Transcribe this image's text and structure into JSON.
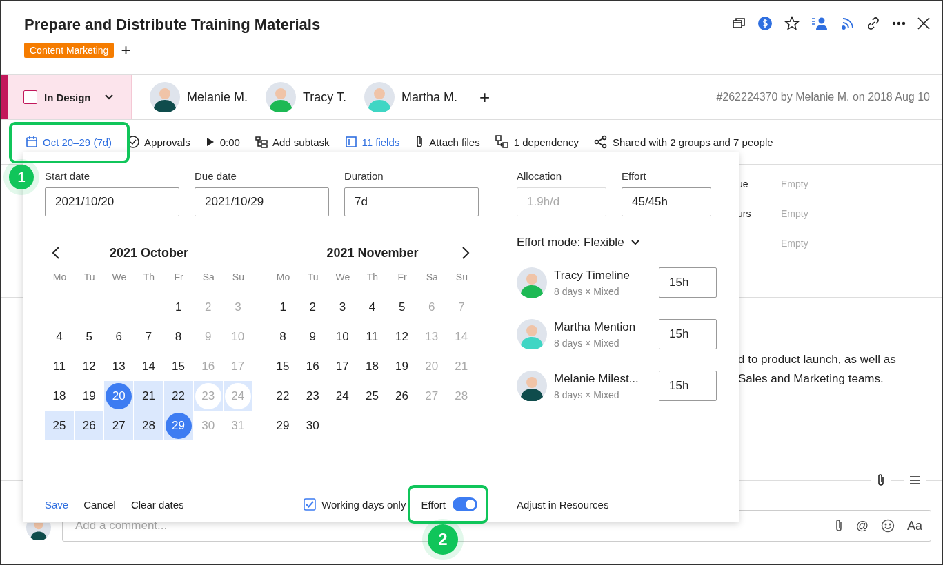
{
  "task": {
    "title": "Prepare and Distribute Training Materials",
    "tags": [
      {
        "label": "Content Marketing",
        "color": "#f57c00"
      }
    ],
    "add_tag": "+"
  },
  "header_icons": [
    {
      "kind": "windows"
    },
    {
      "kind": "dollar"
    },
    {
      "kind": "star"
    },
    {
      "kind": "assign"
    },
    {
      "kind": "feed"
    },
    {
      "kind": "link"
    },
    {
      "kind": "more"
    },
    {
      "kind": "close"
    }
  ],
  "status": {
    "label": "In Design",
    "checked": false,
    "color": "#c2185b"
  },
  "assignees": [
    {
      "name": "Melanie M.",
      "color": "#0f4c4c"
    },
    {
      "name": "Tracy T.",
      "color": "#1db954"
    },
    {
      "name": "Martha M.",
      "color": "#3fd6c4"
    }
  ],
  "add_assignee": "+",
  "meta": "#262224370 by Melanie M. on 2018 Aug 10",
  "toolbar": [
    {
      "kind": "date",
      "label": "Oct 20–29 (7d)",
      "highlighted": true
    },
    {
      "kind": "approvals",
      "label": "Approvals",
      "highlighted": false
    },
    {
      "kind": "timer",
      "label": "0:00",
      "highlighted": false
    },
    {
      "kind": "subtask",
      "label": "Add subtask",
      "highlighted": false
    },
    {
      "kind": "fields",
      "label": "11 fields",
      "highlighted": true
    },
    {
      "kind": "attach",
      "label": "Attach files",
      "highlighted": false
    },
    {
      "kind": "dependency",
      "label": "1 dependency",
      "highlighted": false
    },
    {
      "kind": "share",
      "label": "Shared with 2 groups and 7 people",
      "highlighted": false
    }
  ],
  "fields": [
    {
      "label": "ue",
      "placeholder": "Empty"
    },
    {
      "label": "urs",
      "placeholder": "Empty"
    },
    {
      "placeholder": "Empty"
    }
  ],
  "description": [
    "d to product launch, as well as",
    "Sales and Marketing teams."
  ],
  "comment": {
    "placeholder": "Add a comment...",
    "mention_symbol": "@",
    "format_label": "Aa"
  },
  "date_popover": {
    "inputs": [
      {
        "label": "Start date",
        "value": "2021/10/20"
      },
      {
        "label": "Due date",
        "value": "2021/10/29"
      },
      {
        "label": "Duration",
        "value": "7d"
      }
    ],
    "months": [
      {
        "title": "2021 October",
        "weekdays": [
          "Mo",
          "Tu",
          "We",
          "Th",
          "Fr",
          "Sa",
          "Su"
        ],
        "weeks": [
          [
            {
              "day": "1",
              "weekend": false,
              "selected": false,
              "in_range": false
            },
            {
              "day": "2",
              "weekend": true,
              "selected": false,
              "in_range": false
            },
            {
              "day": "3",
              "weekend": true,
              "selected": false,
              "in_range": false
            }
          ],
          [
            {
              "day": "4",
              "weekend": false,
              "selected": false,
              "in_range": false
            },
            {
              "day": "5",
              "weekend": false,
              "selected": false,
              "in_range": false
            },
            {
              "day": "6",
              "weekend": false,
              "selected": false,
              "in_range": false
            },
            {
              "day": "7",
              "weekend": false,
              "selected": false,
              "in_range": false
            },
            {
              "day": "8",
              "weekend": false,
              "selected": false,
              "in_range": false
            },
            {
              "day": "9",
              "weekend": true,
              "selected": false,
              "in_range": false
            },
            {
              "day": "10",
              "weekend": true,
              "selected": false,
              "in_range": false
            }
          ],
          [
            {
              "day": "11",
              "weekend": false,
              "selected": false,
              "in_range": false
            },
            {
              "day": "12",
              "weekend": false,
              "selected": false,
              "in_range": false
            },
            {
              "day": "13",
              "weekend": false,
              "selected": false,
              "in_range": false
            },
            {
              "day": "14",
              "weekend": false,
              "selected": false,
              "in_range": false
            },
            {
              "day": "15",
              "weekend": false,
              "selected": false,
              "in_range": false
            },
            {
              "day": "16",
              "weekend": true,
              "selected": false,
              "in_range": false
            },
            {
              "day": "17",
              "weekend": true,
              "selected": false,
              "in_range": false
            }
          ],
          [
            {
              "day": "18",
              "weekend": false,
              "selected": false,
              "in_range": false
            },
            {
              "day": "19",
              "weekend": false,
              "selected": false,
              "in_range": false
            },
            {
              "day": "20",
              "weekend": false,
              "selected": true,
              "in_range": true
            },
            {
              "day": "21",
              "weekend": false,
              "selected": false,
              "in_range": true
            },
            {
              "day": "22",
              "weekend": false,
              "selected": false,
              "in_range": true
            },
            {
              "day": "23",
              "weekend": true,
              "selected": false,
              "in_range": true
            },
            {
              "day": "24",
              "weekend": true,
              "selected": false,
              "in_range": true
            }
          ],
          [
            {
              "day": "25",
              "weekend": false,
              "selected": false,
              "in_range": true
            },
            {
              "day": "26",
              "weekend": false,
              "selected": false,
              "in_range": true
            },
            {
              "day": "27",
              "weekend": false,
              "selected": false,
              "in_range": true
            },
            {
              "day": "28",
              "weekend": false,
              "selected": false,
              "in_range": true
            },
            {
              "day": "29",
              "weekend": false,
              "selected": true,
              "in_range": true
            },
            {
              "day": "30",
              "weekend": true,
              "selected": false,
              "in_range": false
            },
            {
              "day": "31",
              "weekend": true,
              "selected": false,
              "in_range": false
            }
          ]
        ]
      },
      {
        "title": "2021 November",
        "weekdays": [
          "Mo",
          "Tu",
          "We",
          "Th",
          "Fr",
          "Sa",
          "Su"
        ],
        "weeks": [
          [
            {
              "day": "1",
              "weekend": false,
              "selected": false,
              "in_range": false
            },
            {
              "day": "2",
              "weekend": false,
              "selected": false,
              "in_range": false
            },
            {
              "day": "3",
              "weekend": false,
              "selected": false,
              "in_range": false
            },
            {
              "day": "4",
              "weekend": false,
              "selected": false,
              "in_range": false
            },
            {
              "day": "5",
              "weekend": false,
              "selected": false,
              "in_range": false
            },
            {
              "day": "6",
              "weekend": true,
              "selected": false,
              "in_range": false
            },
            {
              "day": "7",
              "weekend": true,
              "selected": false,
              "in_range": false
            }
          ],
          [
            {
              "day": "8",
              "weekend": false,
              "selected": false,
              "in_range": false
            },
            {
              "day": "9",
              "weekend": false,
              "selected": false,
              "in_range": false
            },
            {
              "day": "10",
              "weekend": false,
              "selected": false,
              "in_range": false
            },
            {
              "day": "11",
              "weekend": false,
              "selected": false,
              "in_range": false
            },
            {
              "day": "12",
              "weekend": false,
              "selected": false,
              "in_range": false
            },
            {
              "day": "13",
              "weekend": true,
              "selected": false,
              "in_range": false
            },
            {
              "day": "14",
              "weekend": true,
              "selected": false,
              "in_range": false
            }
          ],
          [
            {
              "day": "15",
              "weekend": false,
              "selected": false,
              "in_range": false
            },
            {
              "day": "16",
              "weekend": false,
              "selected": false,
              "in_range": false
            },
            {
              "day": "17",
              "weekend": false,
              "selected": false,
              "in_range": false
            },
            {
              "day": "18",
              "weekend": false,
              "selected": false,
              "in_range": false
            },
            {
              "day": "19",
              "weekend": false,
              "selected": false,
              "in_range": false
            },
            {
              "day": "20",
              "weekend": true,
              "selected": false,
              "in_range": false
            },
            {
              "day": "21",
              "weekend": true,
              "selected": false,
              "in_range": false
            }
          ],
          [
            {
              "day": "22",
              "weekend": false,
              "selected": false,
              "in_range": false
            },
            {
              "day": "23",
              "weekend": false,
              "selected": false,
              "in_range": false
            },
            {
              "day": "24",
              "weekend": false,
              "selected": false,
              "in_range": false
            },
            {
              "day": "25",
              "weekend": false,
              "selected": false,
              "in_range": false
            },
            {
              "day": "26",
              "weekend": false,
              "selected": false,
              "in_range": false
            },
            {
              "day": "27",
              "weekend": true,
              "selected": false,
              "in_range": false
            },
            {
              "day": "28",
              "weekend": true,
              "selected": false,
              "in_range": false
            }
          ],
          [
            {
              "day": "29",
              "weekend": false,
              "selected": false,
              "in_range": false
            },
            {
              "day": "30",
              "weekend": false,
              "selected": false,
              "in_range": false
            }
          ]
        ]
      }
    ],
    "footer": {
      "save": "Save",
      "cancel": "Cancel",
      "clear": "Clear dates",
      "working_days": {
        "label": "Working days only",
        "checked": true
      },
      "effort_toggle": {
        "label": "Effort",
        "on": true
      }
    },
    "allocation": {
      "label": "Allocation",
      "value": "1.9h/d",
      "disabled": true
    },
    "effort": {
      "label": "Effort",
      "value": "45/45h"
    },
    "effort_mode": "Effort mode: Flexible",
    "people": [
      {
        "name": "Tracy Timeline",
        "detail": "8 days × Mixed",
        "hours": "15h",
        "color": "#1db954"
      },
      {
        "name": "Martha Mention",
        "detail": "8 days × Mixed",
        "hours": "15h",
        "color": "#3fd6c4"
      },
      {
        "name": "Melanie Milest...",
        "detail": "8 days × Mixed",
        "hours": "15h",
        "color": "#0f4c4c"
      }
    ],
    "adjust_link": "Adjust in Resources"
  },
  "annotations": [
    {
      "label": "1"
    },
    {
      "label": "2"
    }
  ]
}
